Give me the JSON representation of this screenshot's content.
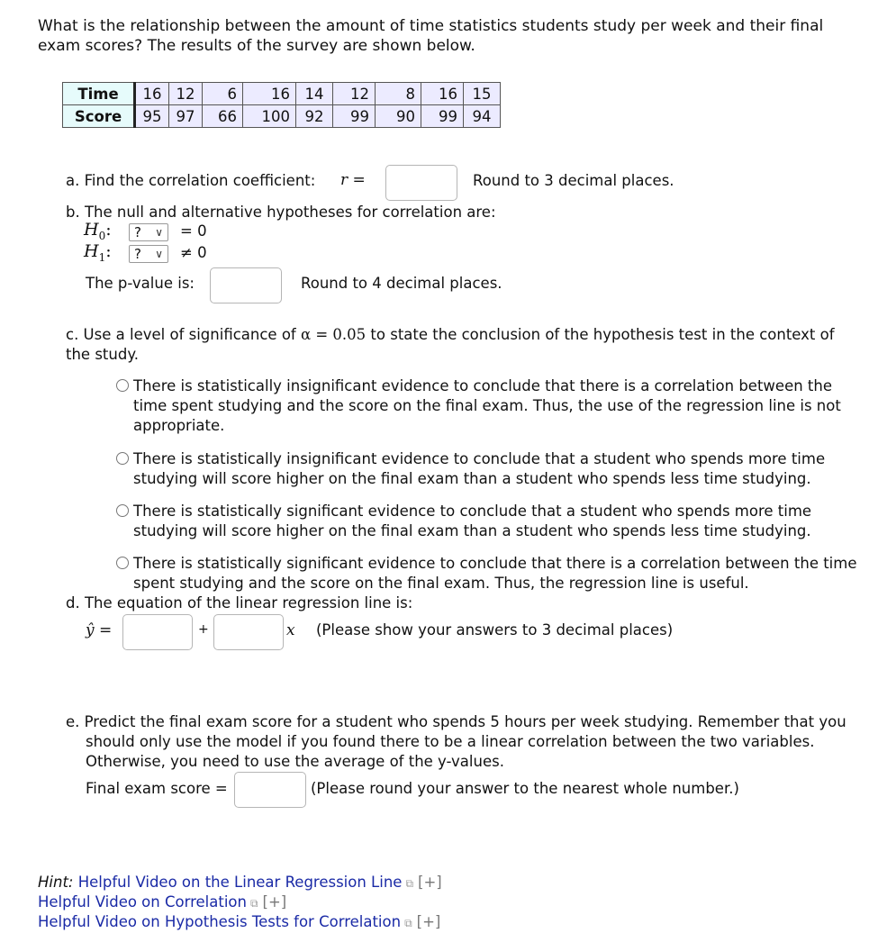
{
  "question": {
    "intro": "What is the relationship between the amount of time statistics students study per week and their final exam scores? The results of the survey are shown below."
  },
  "table": {
    "rows": [
      {
        "label": "Time",
        "values": [
          "16",
          "12",
          "6",
          "16",
          "14",
          "12",
          "8",
          "16",
          "15"
        ]
      },
      {
        "label": "Score",
        "values": [
          "95",
          "97",
          "66",
          "100",
          "92",
          "99",
          "90",
          "99",
          "94"
        ]
      }
    ]
  },
  "part_a": {
    "prefix": "a. Find the correlation coefficient:",
    "symbol": "r =",
    "value": "",
    "note": "Round to 3 decimal places."
  },
  "part_b": {
    "prefix": "b. The null and alternative hypotheses for correlation are:",
    "h0_label": "H",
    "h0_sub": "0",
    "h0_select": "?",
    "h0_relation": "= 0",
    "h1_label": "H",
    "h1_sub": "1",
    "h1_select": "?",
    "h1_relation": "≠ 0",
    "pvalue_label": "The p-value is:",
    "pvalue_value": "",
    "pvalue_note": "Round to 4 decimal places."
  },
  "part_c": {
    "prefix_1": "c. Use a level of significance of",
    "alpha": "α = 0.05",
    "prefix_2": "to state the conclusion of the hypothesis test in the context of the study.",
    "options": [
      "There is statistically insignificant evidence to conclude that there is a correlation between the time spent studying and the score on the final exam. Thus, the use of the regression line is not appropriate.",
      "There is statistically insignificant evidence to conclude that a student who spends more time studying will score higher on the final exam than a student who spends less time studying.",
      "There is statistically significant evidence to conclude that a student who spends more time studying will score higher on the final exam than a student who spends less time studying.",
      "There is statistically significant evidence to conclude that there is a correlation between the time spent studying and the score on the final exam. Thus, the regression line is useful."
    ]
  },
  "part_d": {
    "prefix": "d. The equation of the linear regression line is:",
    "yhat": "ŷ =",
    "plus": "+",
    "x": "x",
    "intercept_value": "",
    "slope_value": "",
    "note": "(Please show your answers to 3 decimal places)"
  },
  "part_e": {
    "text": "e. Predict the final exam score for a student who spends 5 hours per week studying. Remember that you should only use the model if you found there to be a linear correlation between the two variables. Otherwise, you need to use the average of the y-values.",
    "label": "Final exam score =",
    "value": "",
    "note": "(Please round your answer to the nearest whole number.)"
  },
  "hints": {
    "hint_label": "Hint:",
    "links": [
      {
        "text": "Helpful Video on the Linear Regression Line",
        "expand": "[+]"
      },
      {
        "text": "Helpful Video on Correlation",
        "expand": "[+]"
      },
      {
        "text": "Helpful Video on Hypothesis Tests for Correlation",
        "expand": "[+]"
      }
    ],
    "external_icon": "external-link-icon"
  }
}
